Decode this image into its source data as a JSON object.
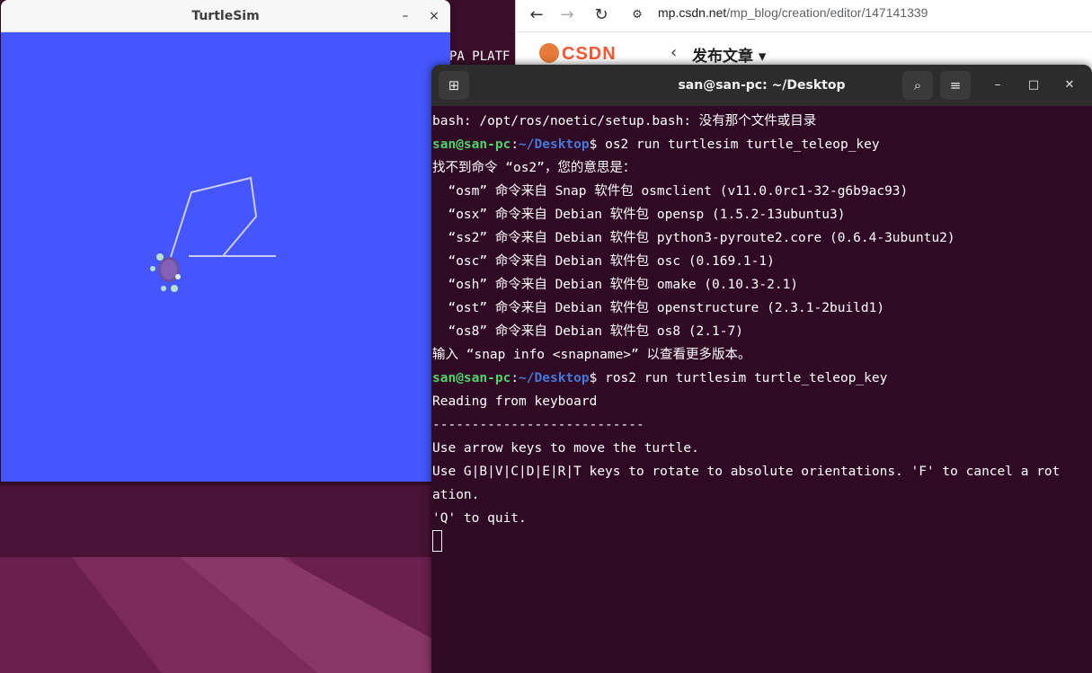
{
  "turtlesim": {
    "title": "TurtleSim",
    "minimize_glyph": "–",
    "close_glyph": "×",
    "canvas_color": "#4556ff",
    "trail_color": "#c9cdf6"
  },
  "browser": {
    "url_host": "mp.csdn.net",
    "url_path": "/mp_blog/creation/editor/147141339",
    "logo_text": "CSDN",
    "page_title": "发布文章 ▾"
  },
  "background_text": "PA PLATF",
  "terminal": {
    "title": "san@san-pc: ~/Desktop",
    "prompt_user": "san@san-pc",
    "prompt_path": "~/Desktop",
    "lines": [
      "bash: /opt/ros/noetic/setup.bash: 没有那个文件或目录",
      "找不到命令 “os2”，您的意思是：",
      "  “osm” 命令来自 Snap 软件包 osmclient (v11.0.0rc1-32-g6b9ac93)",
      "  “osx” 命令来自 Debian 软件包 opensp (1.5.2-13ubuntu3)",
      "  “ss2” 命令来自 Debian 软件包 python3-pyroute2.core (0.6.4-3ubuntu2)",
      "  “osc” 命令来自 Debian 软件包 osc (0.169.1-1)",
      "  “osh” 命令来自 Debian 软件包 omake (0.10.3-2.1)",
      "  “ost” 命令来自 Debian 软件包 openstructure (2.3.1-2build1)",
      "  “os8” 命令来自 Debian 软件包 os8 (2.1-7)",
      "输入 “snap info <snapname>” 以查看更多版本。",
      "Reading from keyboard",
      "---------------------------",
      "Use arrow keys to move the turtle.",
      "Use G|B|V|C|D|E|R|T keys to rotate to absolute orientations. 'F' to cancel a rot",
      "ation.",
      "'Q' to quit."
    ],
    "cmd1": "$ os2 run turtlesim turtle_teleop_key",
    "cmd2": "$ ros2 run turtlesim turtle_teleop_key",
    "colors": {
      "bg": "#300a24",
      "user": "#4fd36a",
      "path": "#4478d8"
    }
  }
}
